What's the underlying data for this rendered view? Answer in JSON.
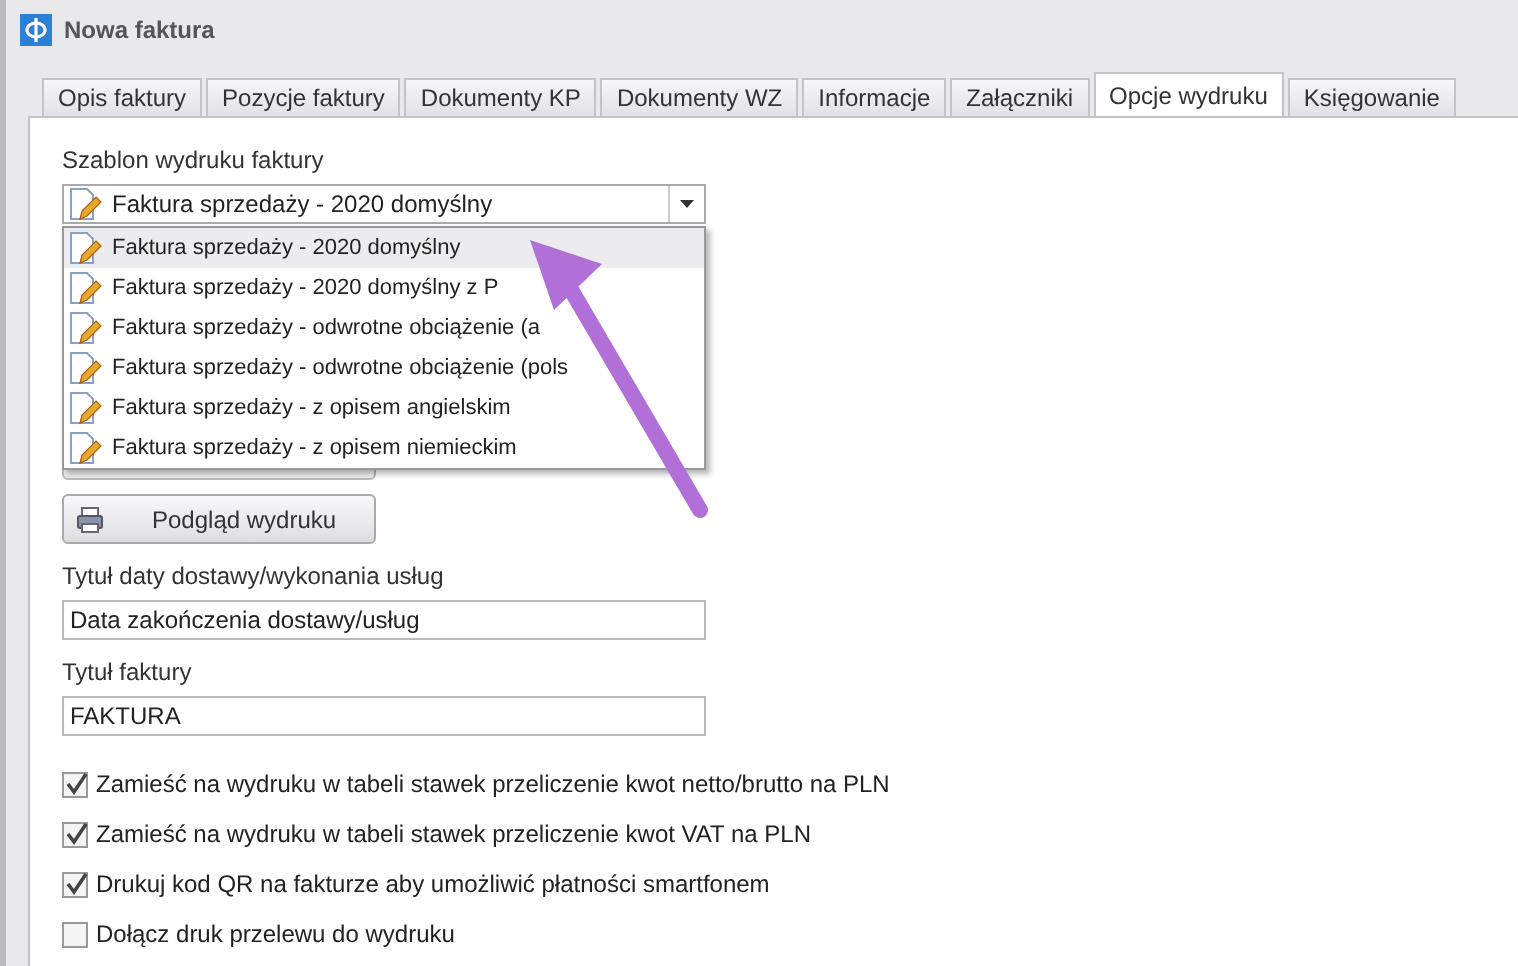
{
  "window": {
    "title": "Nowa faktura"
  },
  "tabs": [
    {
      "label": "Opis faktury",
      "selected": false
    },
    {
      "label": "Pozycje faktury",
      "selected": false
    },
    {
      "label": "Dokumenty KP",
      "selected": false
    },
    {
      "label": "Dokumenty WZ",
      "selected": false
    },
    {
      "label": "Informacje",
      "selected": false
    },
    {
      "label": "Załączniki",
      "selected": false
    },
    {
      "label": "Opcje wydruku",
      "selected": true
    },
    {
      "label": "Księgowanie",
      "selected": false
    }
  ],
  "template": {
    "label": "Szablon wydruku faktury",
    "value": "Faktura sprzedaży - 2020 domyślny",
    "expanded": true,
    "options": [
      {
        "label": "Faktura sprzedaży - 2020 domyślny",
        "selected": true
      },
      {
        "label": "Faktura sprzedaży - 2020 domyślny z P",
        "selected": false
      },
      {
        "label": "Faktura sprzedaży - odwrotne obciążenie (a",
        "selected": false
      },
      {
        "label": "Faktura sprzedaży - odwrotne obciążenie (pols",
        "selected": false
      },
      {
        "label": "Faktura sprzedaży - z opisem angielskim",
        "selected": false
      },
      {
        "label": "Faktura sprzedaży - z opisem niemieckim",
        "selected": false
      }
    ]
  },
  "preview_button": {
    "label": "Podgląd wydruku"
  },
  "fields": [
    {
      "label": "Tytuł daty dostawy/wykonania usług",
      "value": "Data zakończenia dostawy/usług"
    },
    {
      "label": "Tytuł faktury",
      "value": "FAKTURA"
    }
  ],
  "options": [
    {
      "label": "Zamieść na wydruku w tabeli stawek przeliczenie kwot netto/brutto na PLN",
      "checked": true
    },
    {
      "label": "Zamieść na wydruku w tabeli stawek przeliczenie kwot VAT na PLN",
      "checked": true
    },
    {
      "label": "Drukuj kod QR na fakturze aby umożliwić płatności smartfonem",
      "checked": true
    },
    {
      "label": "Dołącz druk przelewu do wydruku",
      "checked": false
    }
  ]
}
